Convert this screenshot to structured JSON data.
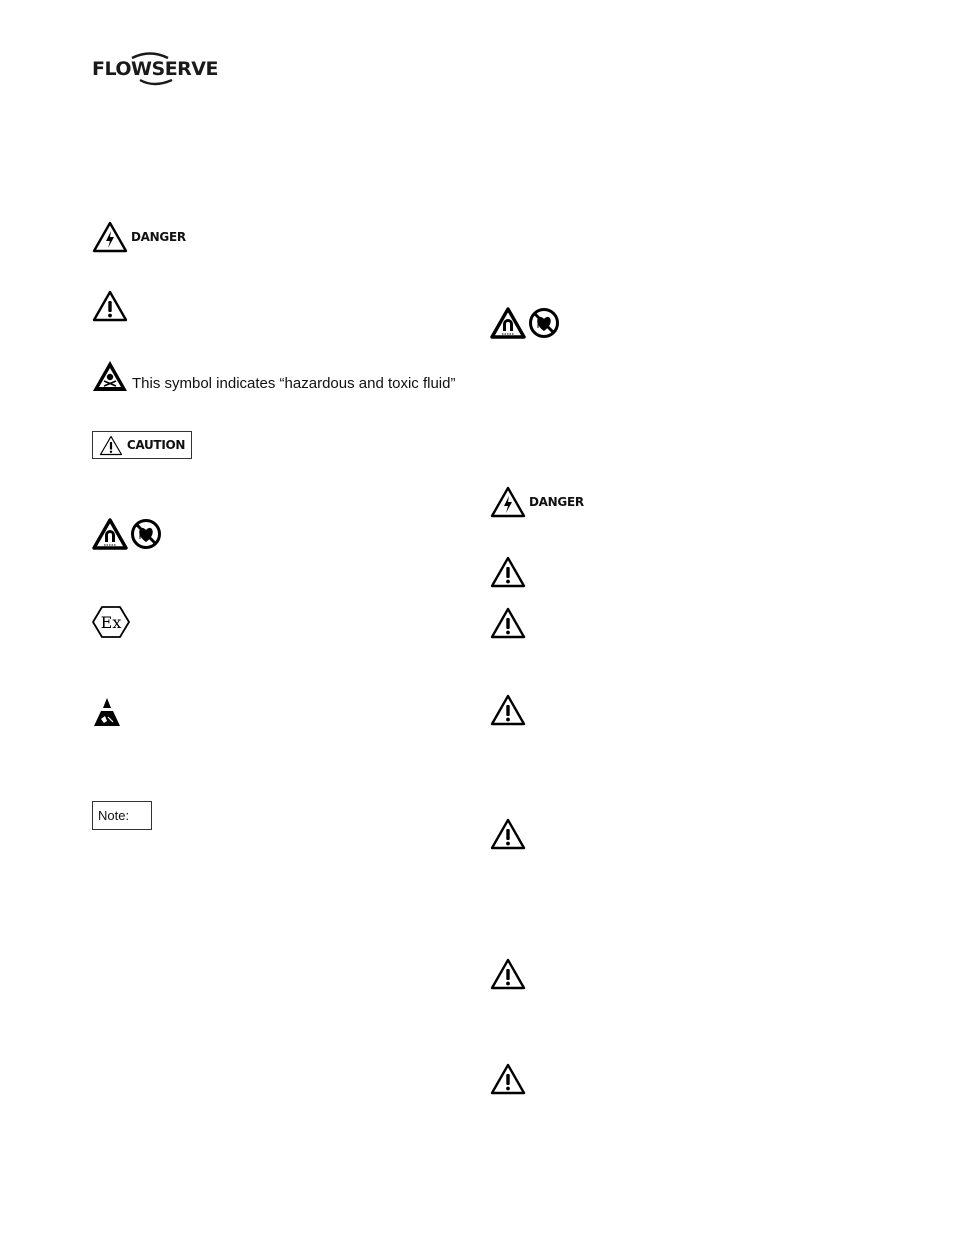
{
  "header": {
    "logo_text": "FLOWSERVE"
  },
  "left_column": {
    "danger_label": "DANGER",
    "toxic_text": "This symbol indicates “hazardous and toxic fluid”",
    "caution_label": "CAUTION",
    "ex_symbol_text": "Ex",
    "note_label": "Note:"
  },
  "right_column": {
    "danger_label": "DANGER"
  },
  "icons": {
    "danger": "electrical-hazard-icon",
    "warning": "warning-triangle-icon",
    "toxic": "toxic-fluid-icon",
    "magnet": "strong-magnetic-field-icon",
    "no_pacemaker": "no-pacemaker-icon",
    "atex": "atex-ex-icon",
    "esd": "electrostatic-discharge-icon"
  }
}
